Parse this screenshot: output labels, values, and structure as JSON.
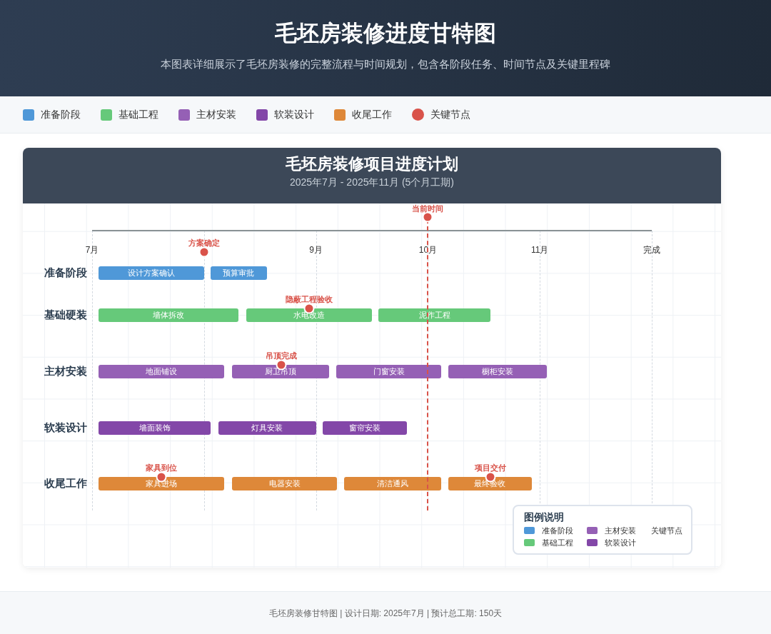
{
  "header": {
    "title": "毛坯房装修进度甘特图",
    "subtitle": "本图表详细展示了毛坯房装修的完整流程与时间规划，包含各阶段任务、时间节点及关键里程碑"
  },
  "legend": [
    {
      "label": "准备阶段",
      "color": "#4f98d8",
      "kind": "square"
    },
    {
      "label": "基础工程",
      "color": "#66c97a",
      "kind": "square"
    },
    {
      "label": "主材安装",
      "color": "#9560b5",
      "kind": "square"
    },
    {
      "label": "软装设计",
      "color": "#8347a8",
      "kind": "square"
    },
    {
      "label": "收尾工作",
      "color": "#de8839",
      "kind": "square"
    },
    {
      "label": "关键节点",
      "color": "#d9534a",
      "kind": "dot"
    }
  ],
  "chart": {
    "title": "毛坯房装修项目进度计划",
    "subtitle": "2025年7月 - 2025年11月 (5个月工期)",
    "axis_labels": [
      "7月",
      "9月",
      "10月",
      "11月",
      "完成"
    ],
    "current_marker": {
      "label": "当前时间"
    },
    "rows": [
      {
        "label": "准备阶段",
        "color": "#4f98d8",
        "tasks": [
          "设计方案确认",
          "预算审批"
        ],
        "milestones": [
          "方案确定"
        ]
      },
      {
        "label": "基础硬装",
        "color": "#66c97a",
        "tasks": [
          "墙体拆改",
          "水电改造",
          "泥作工程"
        ],
        "milestones": [
          "隐蔽工程验收"
        ]
      },
      {
        "label": "主材安装",
        "color": "#9560b5",
        "tasks": [
          "地面铺设",
          "厨卫吊顶",
          "门窗安装",
          "橱柜安装"
        ],
        "milestones": [
          "吊顶完成"
        ]
      },
      {
        "label": "软装设计",
        "color": "#8347a8",
        "tasks": [
          "墙面装饰",
          "灯具安装",
          "窗帘安装"
        ]
      },
      {
        "label": "收尾工作",
        "color": "#de8839",
        "tasks": [
          "家具进场",
          "电器安装",
          "清洁通风",
          "最终验收"
        ],
        "milestones": [
          "家具到位",
          "项目交付"
        ]
      }
    ],
    "legend_box": {
      "title": "图例说明",
      "items": [
        {
          "label": "准备阶段",
          "color": "#4f98d8",
          "kind": "swatch"
        },
        {
          "label": "主材安装",
          "color": "#9560b5",
          "kind": "swatch"
        },
        {
          "label": "关键节点",
          "kind": "plain"
        },
        {
          "label": "基础工程",
          "color": "#66c97a",
          "kind": "swatch"
        },
        {
          "label": "软装设计",
          "color": "#8347a8",
          "kind": "swatch"
        }
      ]
    }
  },
  "footer": "毛坯房装修甘特图 | 设计日期: 2025年7月 | 预计总工期: 150天"
}
